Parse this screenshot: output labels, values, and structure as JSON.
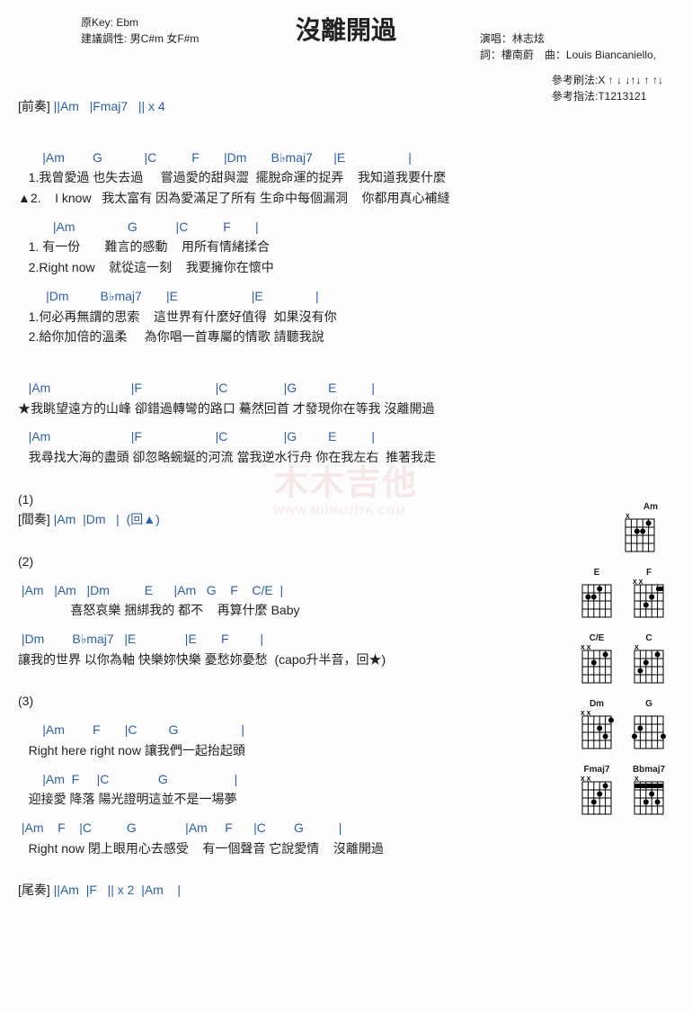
{
  "title": "沒離開過",
  "meta_left": {
    "original_key": "原Key: Ebm",
    "suggest_key": "建議調性: 男C#m 女F#m"
  },
  "meta_right": {
    "singer": "演唱：林志炫",
    "composer": "詞：樓南蔚　曲：Louis Biancaniello,"
  },
  "strum": {
    "line1": "參考刷法:X ↑ ↓ ↓↑↓ ↑ ↑↓",
    "line2": "參考指法:T1213121"
  },
  "intro": {
    "label": "[前奏]",
    "chords": " ||Am   |Fmaj7   || x 4"
  },
  "verse1": {
    "chord_line1": "       |Am        G            |C          F       |Dm       B♭maj7      |E                  |",
    "lyric1a": "   1.我曾愛過 也失去過     嘗過愛的甜與澀  擺脫命運的捉弄    我知道我要什麼",
    "lyric1b": "▲2.    I know   我太富有 因為愛滿足了所有 生命中每個漏洞    你都用真心補縫",
    "chord_line2": "          |Am               G           |C          F       |",
    "lyric2a": "   1. 有一份       難言的感動    用所有情緒揉合",
    "lyric2b": "   2.Right now    就從這一刻    我要擁你在懷中",
    "chord_line3": "        |Dm         B♭maj7       |E                     |E               |",
    "lyric3a": "   1.何必再無謂的思索    這世界有什麼好值得  如果沒有你",
    "lyric3b": "   2.給你加倍的溫柔     為你唱一首專屬的情歌 請聽我說"
  },
  "chorus": {
    "chord_line1": "   |Am                       |F                     |C                |G         E          |",
    "lyric1": "★我眺望遠方的山峰 卻錯過轉彎的路口 驀然回首 才發現你在等我 沒離開過",
    "chord_line2": "   |Am                       |F                     |C                |G         E          |",
    "lyric2": "   我尋找大海的盡頭 卻忽略蜿蜒的河流 當我逆水行舟 你在我左右  推著我走"
  },
  "section1": {
    "label": "(1)",
    "interlude_label": "[間奏]",
    "interlude": " |Am  |Dm   |  (回▲)"
  },
  "section2": {
    "label": "(2)",
    "chord_line1": " |Am   |Am   |Dm          E      |Am   G    F    C/E  |",
    "lyric1": "               喜怒哀樂 捆綁我的 都不    再算什麼 Baby",
    "chord_line2": " |Dm        B♭maj7   |E              |E       F         |",
    "lyric2": "讓我的世界 以你為軸 快樂妳快樂 憂愁妳憂愁  (capo升半音，回★)"
  },
  "section3": {
    "label": "(3)",
    "chord_line1": "       |Am        F       |C         G                  |",
    "lyric1": "   Right here right now 讓我們一起抬起頭",
    "chord_line2": "       |Am  F     |C              G                   |",
    "lyric2": "   迎接愛 降落 陽光證明這並不是一場夢",
    "chord_line3": " |Am    F    |C          G              |Am     F      |C        G          |",
    "lyric3": "   Right now 閉上眼用心去感受    有一個聲音 它說愛情    沒離開過"
  },
  "outro": {
    "label": "[尾奏]",
    "chords": " ||Am  |F   || x 2  |Am    |"
  },
  "watermark": {
    "main": "木木吉他",
    "sub": "WWW.MUMUJITA.COM"
  },
  "chord_diagrams": [
    "Am",
    "E",
    "F",
    "C/E",
    "C",
    "Dm",
    "G",
    "Fmaj7",
    "Bbmaj7"
  ]
}
